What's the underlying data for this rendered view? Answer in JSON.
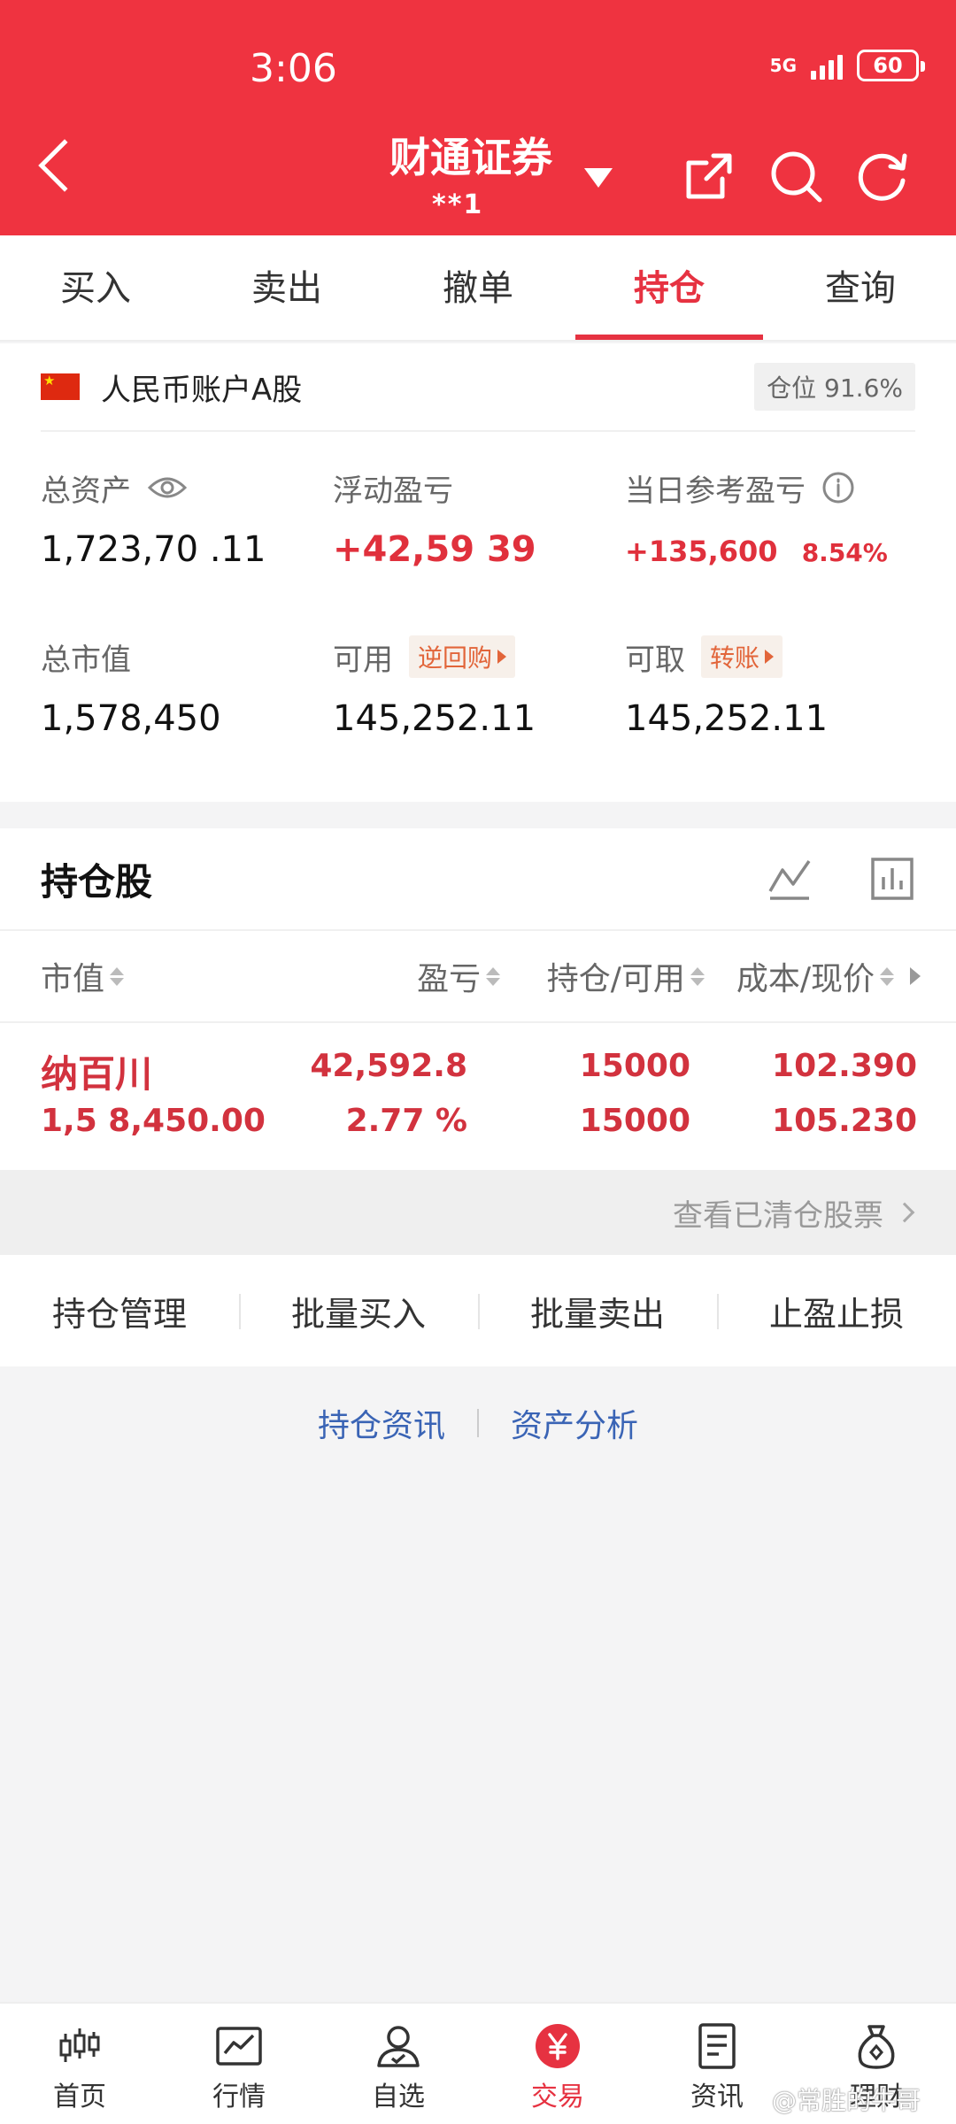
{
  "status_bar": {
    "time": "3:06",
    "network": "5G",
    "battery": "60"
  },
  "header": {
    "title": "财通证券",
    "account_masked": "**1"
  },
  "tabs": [
    {
      "label": "买入"
    },
    {
      "label": "卖出"
    },
    {
      "label": "撤单"
    },
    {
      "label": "持仓",
      "active": true
    },
    {
      "label": "查询"
    }
  ],
  "account": {
    "label": "人民币账户A股",
    "position_ratio": "仓位 91.6%"
  },
  "summary": {
    "total_assets_label": "总资产",
    "total_assets": "1,723,70 .11",
    "floating_pl_label": "浮动盈亏",
    "floating_pl": "+42,59 39",
    "daily_pl_label": "当日参考盈亏",
    "daily_pl": "+135,600",
    "daily_pl_pct": "8.54%",
    "market_value_label": "总市值",
    "market_value": "1,578,450",
    "available_label": "可用",
    "reverse_repo_tag": "逆回购",
    "available": "145,252.11",
    "withdrawable_label": "可取",
    "transfer_tag": "转账",
    "withdrawable": "145,252.11"
  },
  "holdings_section": {
    "title": "持仓股",
    "columns": {
      "market_value": "市值",
      "profit_loss": "盈亏",
      "position": "持仓/可用",
      "cost_price": "成本/现价"
    },
    "rows": [
      {
        "name": "纳百川",
        "market_value": "1,5 8,450.00",
        "pl_amount": "42,592.8",
        "pl_pct": "2.77 %",
        "position": "15000",
        "available": "15000",
        "cost": "102.390",
        "price": "105.230"
      }
    ]
  },
  "cleared_link": "查看已清仓股票",
  "actions": [
    "持仓管理",
    "批量买入",
    "批量卖出",
    "止盈止损"
  ],
  "links": {
    "holdings_news": "持仓资讯",
    "asset_analysis": "资产分析"
  },
  "bottom_nav": [
    {
      "label": "首页",
      "icon": "candlestick-icon"
    },
    {
      "label": "行情",
      "icon": "line-chart-icon"
    },
    {
      "label": "自选",
      "icon": "user-check-icon"
    },
    {
      "label": "交易",
      "icon": "yen-icon",
      "active": true
    },
    {
      "label": "资讯",
      "icon": "document-icon"
    },
    {
      "label": "理财",
      "icon": "money-bag-icon"
    }
  ],
  "watermark": "@常胜的牛哥",
  "colors": {
    "brand_red": "#ef3340",
    "profit_red": "#e0303c",
    "link_blue": "#3a64b5",
    "tag_orange": "#e2653a"
  }
}
